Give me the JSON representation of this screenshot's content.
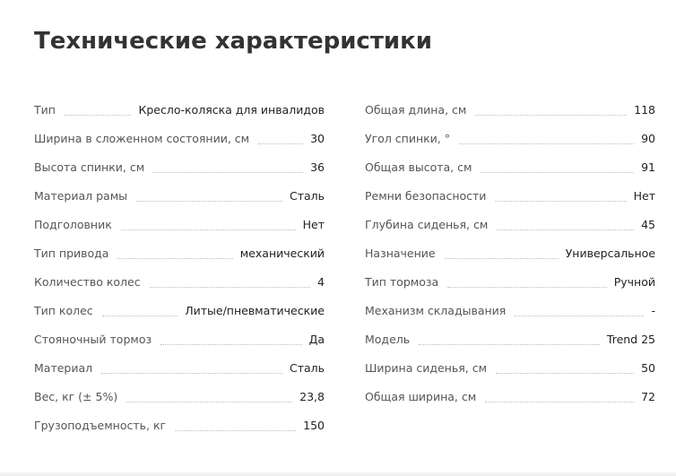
{
  "page": {
    "title": "Технические характеристики"
  },
  "specs": {
    "left": [
      {
        "label": "Тип",
        "value": "Кресло-коляска для инвалидов"
      },
      {
        "label": "Ширина в сложенном состоянии, см",
        "value": "30"
      },
      {
        "label": "Высота спинки, см",
        "value": "36"
      },
      {
        "label": "Материал рамы",
        "value": "Сталь"
      },
      {
        "label": "Подголовник",
        "value": "Нет"
      },
      {
        "label": "Тип привода",
        "value": "механический"
      },
      {
        "label": "Количество колес",
        "value": "4"
      },
      {
        "label": "Тип колес",
        "value": "Литые/пневматические"
      },
      {
        "label": "Стояночный тормоз",
        "value": "Да"
      },
      {
        "label": "Материал",
        "value": "Сталь"
      },
      {
        "label": "Вес, кг (± 5%)",
        "value": "23,8"
      },
      {
        "label": "Грузоподъемность, кг",
        "value": "150"
      }
    ],
    "right": [
      {
        "label": "Общая длина, см",
        "value": "118"
      },
      {
        "label": "Угол спинки, °",
        "value": "90"
      },
      {
        "label": "Общая высота, см",
        "value": "91"
      },
      {
        "label": "Ремни безопасности",
        "value": "Нет"
      },
      {
        "label": "Глубина сиденья, см",
        "value": "45"
      },
      {
        "label": "Назначение",
        "value": "Универсальное"
      },
      {
        "label": "Тип тормоза",
        "value": "Ручной"
      },
      {
        "label": "Механизм складывания",
        "value": "-"
      },
      {
        "label": "Модель",
        "value": "Trend 25"
      },
      {
        "label": "Ширина сиденья, см",
        "value": "50"
      },
      {
        "label": "Общая ширина, см",
        "value": "72"
      }
    ]
  }
}
